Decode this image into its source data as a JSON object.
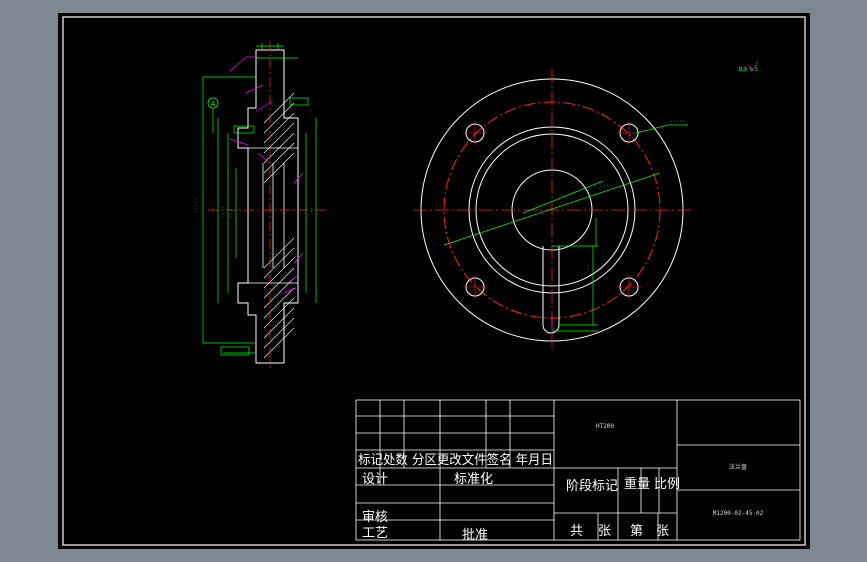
{
  "colors": {
    "background_outer": "#7e8893",
    "paper": "#000000",
    "outline": "#ffffff",
    "center_line": "#ff2020",
    "dimension": "#00ff00",
    "leader": "#ff00ff",
    "hatch": "#ffffff"
  },
  "title_block": {
    "material": "HT200",
    "part_name": "法兰盘",
    "drawing_no": "M1200-02-45-02",
    "row_labels": "标记处数 分区更改文件签名 年月日",
    "design": "设计",
    "standardize": "标准化",
    "stage_mark": "阶段标记",
    "weight": "重量",
    "scale": "比例",
    "review": "审核",
    "process": "工艺",
    "approve": "批准",
    "total": "共",
    "sheet_word": "张",
    "page": "第",
    "sheet_word2": "张"
  },
  "annotations": {
    "roughness_global": "其余 6.3",
    "datum_label": "A"
  }
}
